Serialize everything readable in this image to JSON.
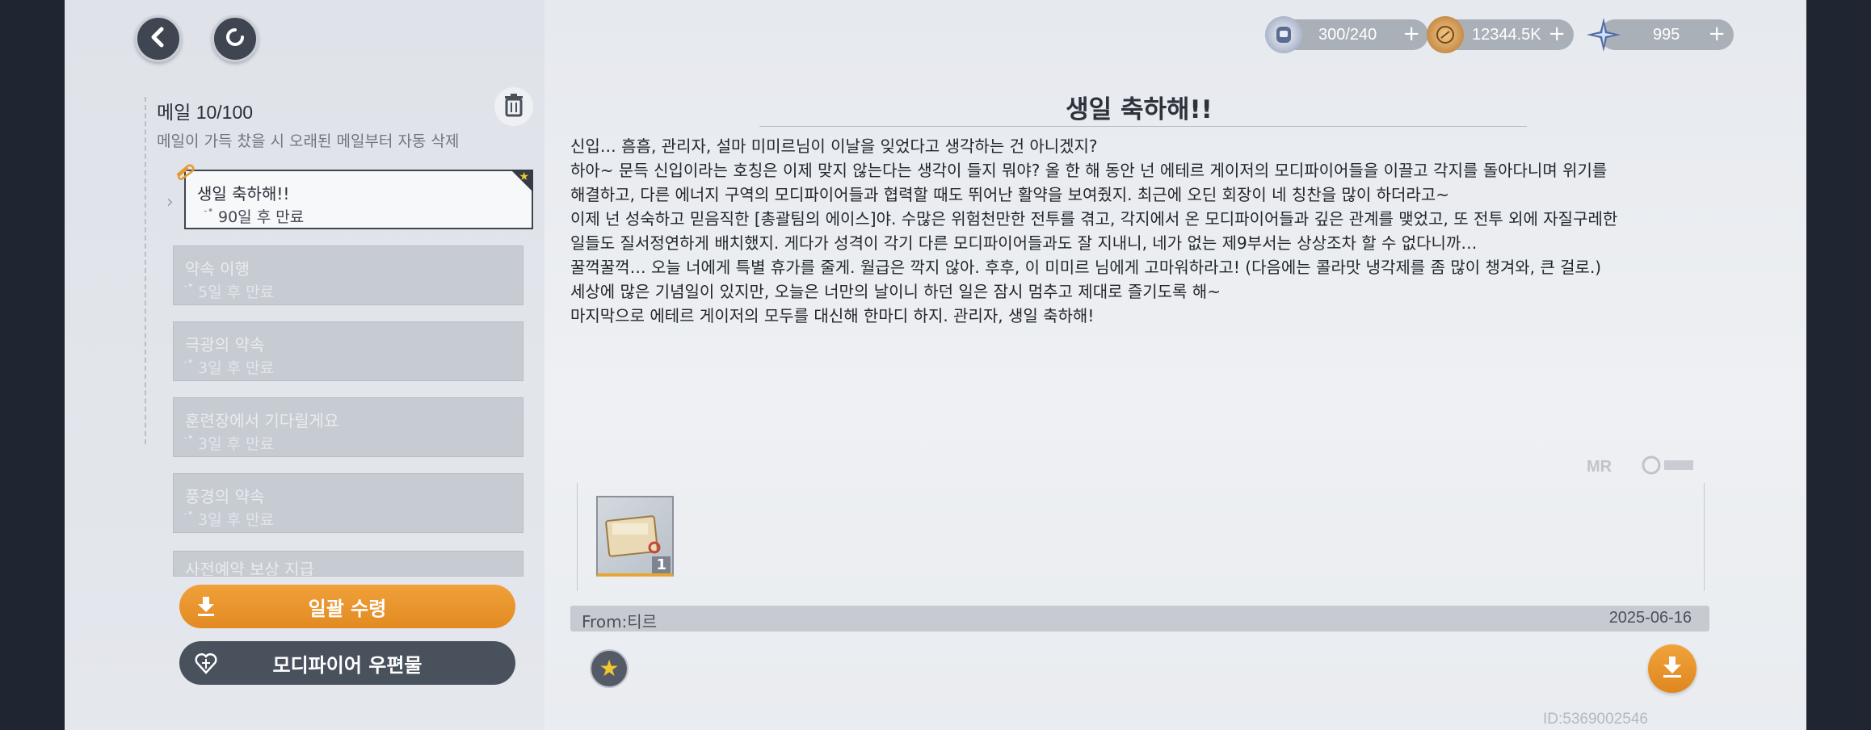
{
  "nav": {
    "back_icon": "chevron-left-icon",
    "refresh_icon": "refresh-icon"
  },
  "currencies": [
    {
      "icon": "stamina-icon",
      "value": "300/240"
    },
    {
      "icon": "gold-coin-icon",
      "value": "12344.5K"
    },
    {
      "icon": "crystal-star-icon",
      "value": "995"
    }
  ],
  "mailbox": {
    "count_label": "메일 10/100",
    "notice": "메일이 가득 찼을 시 오래된 메일부터 자동 삭제",
    "items": [
      {
        "title": "생일 축하해!!",
        "expiry": "90일 후 만료",
        "active": true
      },
      {
        "title": "약속 이행",
        "expiry": "5일 후 만료"
      },
      {
        "title": "극광의 약속",
        "expiry": "3일 후 만료"
      },
      {
        "title": "훈련장에서 기다릴게요",
        "expiry": "3일 후 만료"
      },
      {
        "title": "풍경의 약속",
        "expiry": "3일 후 만료"
      },
      {
        "title": "사전예약 보상 지급",
        "expiry": ""
      }
    ]
  },
  "actions": {
    "claim_all": "일괄 수령",
    "modifier_post": "모디파이어 우편물"
  },
  "mail": {
    "title": "생일 축하해!!",
    "body": [
      "신입… 흠흠, 관리자, 설마 미미르님이 이날을 잊었다고 생각하는 건 아니겠지?",
      "하아~ 문득 신입이라는 호칭은 이제 맞지 않는다는 생각이 들지 뭐야? 올 한 해 동안 넌 에테르 게이저의 모디파이어들을 이끌고 각지를 돌아다니며 위기를",
      "해결하고, 다른 에너지 구역의 모디파이어들과 협력할 때도 뛰어난 활약을 보여줬지. 최근에 오딘 회장이 네 칭찬을 많이 하더라고~",
      "이제 넌 성숙하고 믿음직한 [총괄팀의 에이스]야. 수많은 위험천만한 전투를 겪고, 각지에서 온 모디파이어들과 깊은 관계를 맺었고, 또 전투 외에 자질구레한",
      "일들도 질서정연하게 배치했지. 게다가 성격이 각기 다른 모디파이어들과도 잘 지내니, 네가 없는 제9부서는 상상조차 할 수 없다니까…",
      "꿀꺽꿀꺽… 오늘 너에게 특별 휴가를 줄게. 월급은 깍지 않아. 후후, 이 미미르 님에게 고마워하라고! (다음에는 콜라맛 냉각제를 좀 많이 챙겨와, 큰 걸로.)",
      "세상에 많은 기념일이 있지만, 오늘은 너만의 날이니 하던 일은 잠시 멈추고 제대로 즐기도록 해~",
      "마지막으로 에테르 게이저의 모두를 대신해 한마디 하지. 관리자, 생일 축하해!"
    ],
    "attachment": {
      "icon": "photo-album-icon",
      "count": "1"
    },
    "from": "From:티르",
    "date": "2025-06-16",
    "uid": "ID:5369002546"
  }
}
